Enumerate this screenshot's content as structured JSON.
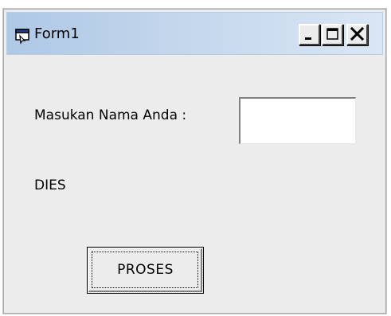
{
  "window": {
    "title": "Form1",
    "icon": "form-icon",
    "controls": {
      "minimize": "minimize-icon",
      "maximize": "maximize-icon",
      "close": "close-icon"
    }
  },
  "form": {
    "name_label": "Masukan Nama Anda :",
    "name_input_value": "",
    "output_label": "DIES",
    "submit_button": "PROSES"
  },
  "colors": {
    "titlebar_start": "#aec8e6",
    "titlebar_end": "#d9e6f4",
    "form_background": "#ececec"
  }
}
